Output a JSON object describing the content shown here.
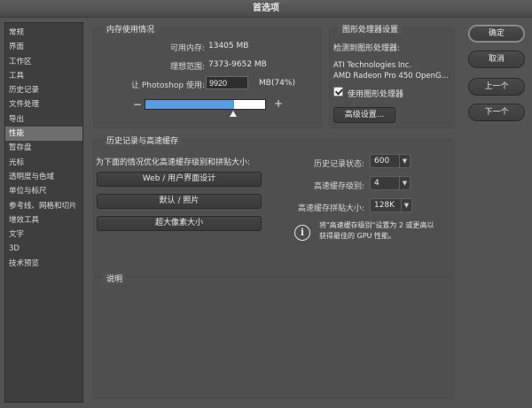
{
  "window": {
    "title": "首选项"
  },
  "sidebar": {
    "items": [
      {
        "label": "常规"
      },
      {
        "label": "界面"
      },
      {
        "label": "工作区"
      },
      {
        "label": "工具"
      },
      {
        "label": "历史记录"
      },
      {
        "label": "文件处理"
      },
      {
        "label": "导出"
      },
      {
        "label": "性能",
        "active": true
      },
      {
        "label": "暂存盘"
      },
      {
        "label": "光标"
      },
      {
        "label": "透明度与色域"
      },
      {
        "label": "单位与标尺"
      },
      {
        "label": "参考线、网格和切片"
      },
      {
        "label": "增效工具"
      },
      {
        "label": "文字"
      },
      {
        "label": "3D"
      },
      {
        "label": "技术预览"
      }
    ]
  },
  "memory": {
    "title": "内存使用情况",
    "available_label": "可用内存:",
    "available_value": "13405 MB",
    "ideal_label": "理想范围:",
    "ideal_value": "7373-9652 MB",
    "use_label": "让 Photoshop 使用:",
    "use_value": "9920",
    "use_suffix": "MB(74%)",
    "minus": "−",
    "plus": "+",
    "slider_percent": 74
  },
  "gpu": {
    "title": "图形处理器设置",
    "detected_label": "检测到图形处理器:",
    "vendor": "ATI Technologies Inc.",
    "model": "AMD Radeon Pro 450 OpenG...",
    "use_gpu_label": "使用图形处理器",
    "use_gpu_checked": true,
    "advanced_button": "高级设置..."
  },
  "history": {
    "title": "历史记录与高速缓存",
    "optimize_label": "为下面的情况优化高速缓存级别和拼贴大小:",
    "preset_web": "Web / 用户界面设计",
    "preset_default": "默认 / 照片",
    "preset_large": "超大像素大小",
    "states_label": "历史记录状态:",
    "states_value": "600",
    "levels_label": "高速缓存级别:",
    "levels_value": "4",
    "tile_label": "高速缓存拼贴大小:",
    "tile_value": "128K",
    "info_line1": "将\"高速缓存级别\"设置为 2 或更高以",
    "info_line2": "获得最佳的 GPU 性能。"
  },
  "description": {
    "title": "说明"
  },
  "buttons": {
    "ok": "确定",
    "cancel": "取消",
    "prev": "上一个",
    "next": "下一个"
  },
  "icons": {
    "info": "info-icon",
    "dropdown": "chevron-down-icon",
    "check": "check-icon"
  }
}
